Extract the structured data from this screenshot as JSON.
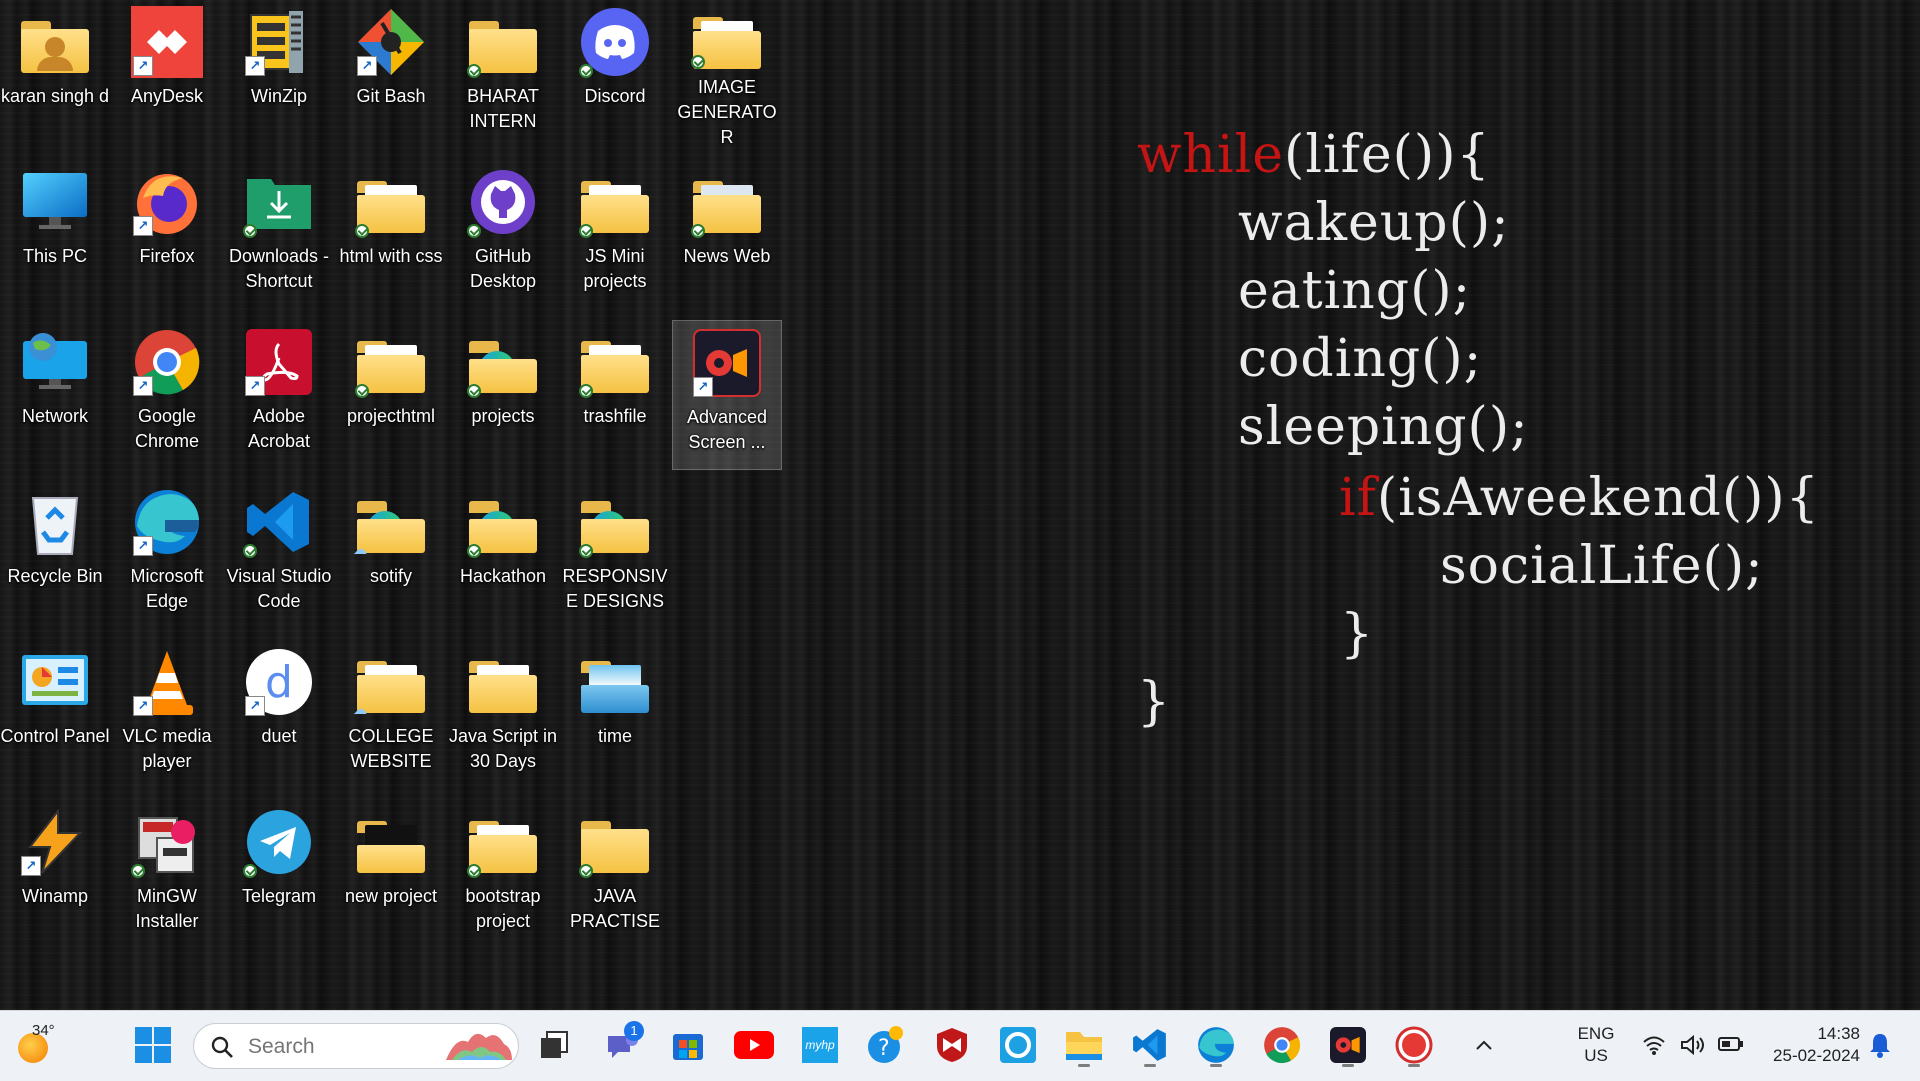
{
  "desktop": {
    "icons": [
      {
        "label": "karan singh d"
      },
      {
        "label": "AnyDesk"
      },
      {
        "label": "WinZip"
      },
      {
        "label": "Git Bash"
      },
      {
        "label": "BHARAT INTERN"
      },
      {
        "label": "Discord"
      },
      {
        "label": "IMAGE GENERATOR"
      },
      {
        "label": "This PC"
      },
      {
        "label": "Firefox"
      },
      {
        "label": "Downloads - Shortcut"
      },
      {
        "label": "html with css"
      },
      {
        "label": "GitHub Desktop"
      },
      {
        "label": "JS Mini projects"
      },
      {
        "label": "News Web"
      },
      {
        "label": "Network"
      },
      {
        "label": "Google Chrome"
      },
      {
        "label": "Adobe Acrobat"
      },
      {
        "label": "projecthtml"
      },
      {
        "label": "projects"
      },
      {
        "label": "trashfile"
      },
      {
        "label": "Advanced Screen ..."
      },
      {
        "label": "Recycle Bin"
      },
      {
        "label": "Microsoft Edge"
      },
      {
        "label": "Visual Studio Code"
      },
      {
        "label": "sotify"
      },
      {
        "label": "Hackathon"
      },
      {
        "label": "RESPONSIVE DESIGNS"
      },
      {
        "label": "Control Panel"
      },
      {
        "label": "VLC media player"
      },
      {
        "label": "duet"
      },
      {
        "label": "COLLEGE WEBSITE"
      },
      {
        "label": "Java Script in 30 Days"
      },
      {
        "label": "time"
      },
      {
        "label": "Winamp"
      },
      {
        "label": "MinGW Installer"
      },
      {
        "label": "Telegram"
      },
      {
        "label": "new project"
      },
      {
        "label": "bootstrap project"
      },
      {
        "label": "JAVA PRACTISE"
      }
    ]
  },
  "wallpaper": {
    "lines": [
      {
        "kw": "while",
        "rest": "(life()){"
      },
      {
        "kw": "",
        "rest": "wakeup();"
      },
      {
        "kw": "",
        "rest": "eating();"
      },
      {
        "kw": "",
        "rest": "coding();"
      },
      {
        "kw": "",
        "rest": "sleeping();"
      },
      {
        "kw": "if",
        "rest": "(isAweekend()){"
      },
      {
        "kw": "",
        "rest": "socialLife();"
      },
      {
        "kw": "",
        "rest": "}"
      },
      {
        "kw": "",
        "rest": "}"
      }
    ]
  },
  "taskbar": {
    "weather_temp": "34°",
    "search_placeholder": "Search",
    "chat_badge": "1",
    "language_line1": "ENG",
    "language_line2": "US",
    "time": "14:38",
    "date": "25-02-2024"
  },
  "colors": {
    "accent_red": "#c41414",
    "taskbar_bg": "#eef2f7"
  }
}
